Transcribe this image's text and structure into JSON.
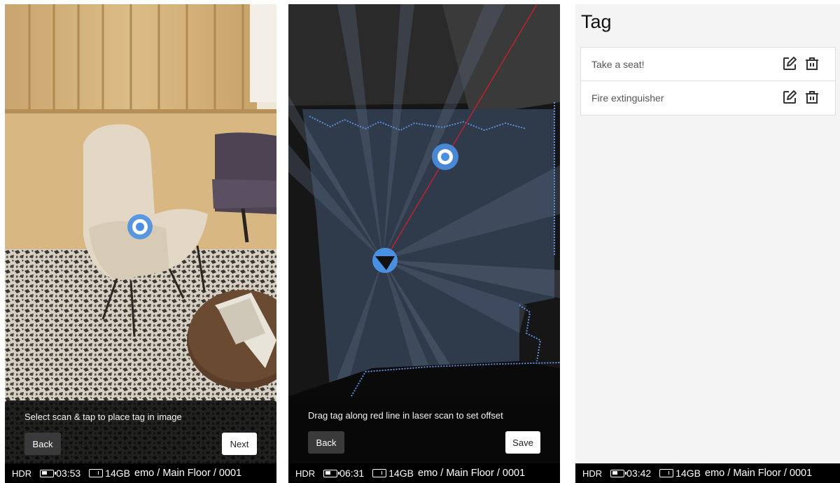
{
  "panels": {
    "place": {
      "instruction": "Select scan & tap to place tag in image",
      "back_label": "Back",
      "next_label": "Next",
      "status": {
        "hdr": "HDR",
        "time": "03:53",
        "storage": "14GB",
        "path": "emo / Main Floor / 0001"
      }
    },
    "offset": {
      "instruction": "Drag tag along red line in laser scan to set offset",
      "back_label": "Back",
      "save_label": "Save",
      "status": {
        "hdr": "HDR",
        "time": "06:31",
        "storage": "14GB",
        "path": "emo / Main Floor / 0001"
      }
    },
    "tags": {
      "title": "Tag",
      "items": [
        {
          "label": "Take a seat!"
        },
        {
          "label": "Fire extinguisher"
        }
      ],
      "status": {
        "hdr": "HDR",
        "time": "03:42",
        "storage": "14GB",
        "path": "emo / Main Floor / 0001"
      }
    }
  },
  "icons": {
    "tag_marker": "target-ring-icon",
    "scan_position": "position-arrow-icon",
    "edit": "edit-pencil-icon",
    "delete": "trash-icon",
    "battery": "battery-icon",
    "storage": "storage-icon"
  },
  "colors": {
    "marker_blue": "#4a90e2",
    "laser_red": "#d0202a",
    "scan_points": "#5d8fdc"
  }
}
